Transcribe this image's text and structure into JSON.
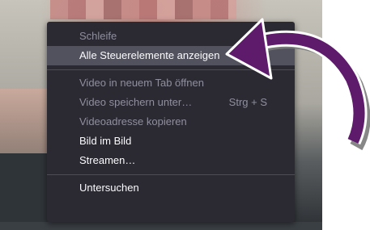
{
  "context_menu": {
    "items": [
      {
        "label": "Schleife",
        "enabled": false
      },
      {
        "label": "Alle Steuerelemente anzeigen",
        "enabled": true,
        "highlighted": true
      },
      {
        "label": "Video in neuem Tab öffnen",
        "enabled": false
      },
      {
        "label": "Video speichern unter…",
        "enabled": false,
        "shortcut": "Strg + S"
      },
      {
        "label": "Videoadresse kopieren",
        "enabled": false
      },
      {
        "label": "Bild im Bild",
        "enabled": true
      },
      {
        "label": "Streamen…",
        "enabled": true
      },
      {
        "label": "Untersuchen",
        "enabled": true
      }
    ]
  },
  "annotation": {
    "arrow_color": "#5e1a6b",
    "arrow_shadow_color": "#7a7a7a"
  },
  "colors": {
    "menu_bg": "#2b2a33",
    "menu_hover_bg": "#52525e",
    "text_enabled": "#fbfbfe",
    "text_disabled": "#8f8f9d"
  }
}
